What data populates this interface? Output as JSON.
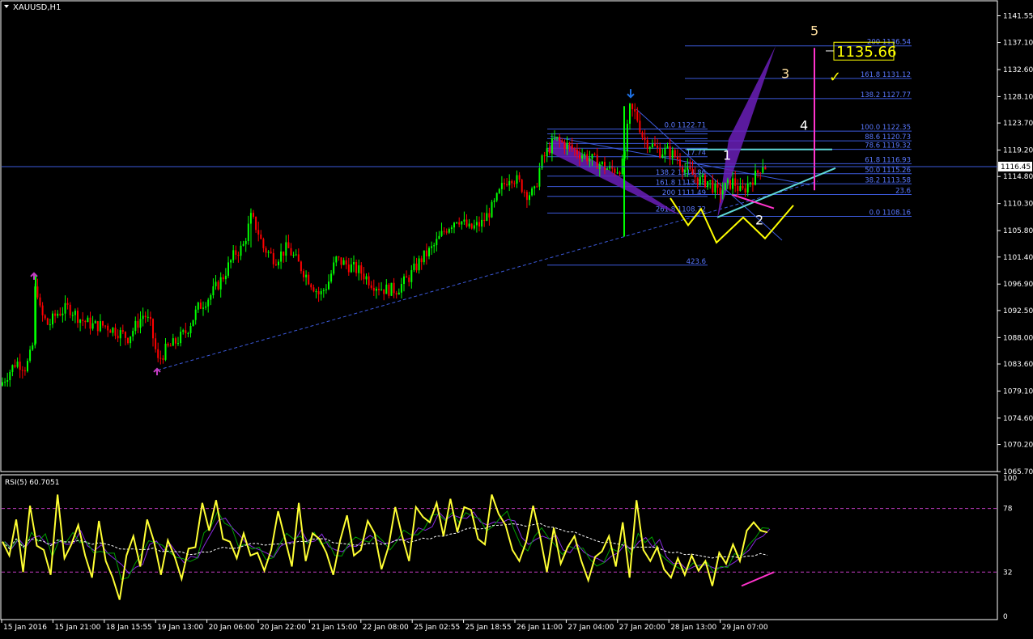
{
  "colors": {
    "background": "#000000",
    "frame": "#ffffff",
    "candle_up": "#00ff00",
    "candle_down": "#ff0000",
    "fib": "#3c5adc",
    "fib_text": "#5a78ff",
    "trend_dashed": "#3c5adc",
    "wave_yellow": "#ffff00",
    "teal": "#5fd7d7",
    "magenta": "#ff33cc",
    "purple_fill": "#6a1fb8",
    "rsi_line": "#ffff33",
    "rsi_signal": "#00a000",
    "rsi_signal2": "#8a2be2",
    "rsi_ma": "#ffffff",
    "rsi_level": "#c23cc2",
    "arrow_up": "#c23cc2",
    "arrow_down": "#1e6fe0",
    "price_label_bg": "#ffffff"
  },
  "header": {
    "symbol_label": "XAUUSD,H1",
    "menu_icon": "triangle-down-icon"
  },
  "chart_data": [
    {
      "type": "candlestick",
      "title": "XAUUSD,H1",
      "ylim": [
        1065.7,
        1143.5
      ],
      "y_ticks": [
        "1141.55",
        "1137.10",
        "1132.60",
        "1128.10",
        "1123.70",
        "1119.20",
        "1114.80",
        "1110.30",
        "1105.80",
        "1101.40",
        "1096.90",
        "1092.50",
        "1088.00",
        "1083.60",
        "1079.10",
        "1074.60",
        "1070.20",
        "1065.70"
      ],
      "current_price": "1116.45",
      "x_ticks": [
        "15 Jan 2016",
        "15 Jan 21:00",
        "18 Jan 15:55",
        "19 Jan 13:00",
        "20 Jan 06:00",
        "20 Jan 22:00",
        "21 Jan 15:00",
        "22 Jan 08:00",
        "25 Jan 02:55",
        "25 Jan 18:55",
        "26 Jan 11:00",
        "27 Jan 04:00",
        "27 Jan 20:00",
        "28 Jan 13:00",
        "29 Jan 07:00"
      ],
      "price_path": [
        [
          0,
          1080
        ],
        [
          10,
          1082
        ],
        [
          20,
          1084
        ],
        [
          32,
          1083
        ],
        [
          40,
          1086
        ],
        [
          44,
          1098
        ],
        [
          50,
          1092
        ],
        [
          60,
          1090
        ],
        [
          70,
          1092
        ],
        [
          85,
          1093
        ],
        [
          100,
          1091
        ],
        [
          115,
          1090
        ],
        [
          130,
          1090
        ],
        [
          145,
          1089
        ],
        [
          158,
          1088
        ],
        [
          168,
          1090
        ],
        [
          178,
          1092
        ],
        [
          186,
          1090
        ],
        [
          195,
          1084
        ],
        [
          205,
          1086
        ],
        [
          215,
          1087
        ],
        [
          230,
          1089
        ],
        [
          245,
          1093
        ],
        [
          260,
          1095
        ],
        [
          275,
          1098
        ],
        [
          290,
          1102
        ],
        [
          300,
          1103
        ],
        [
          310,
          1108
        ],
        [
          318,
          1106
        ],
        [
          325,
          1103
        ],
        [
          340,
          1101
        ],
        [
          355,
          1103
        ],
        [
          365,
          1101
        ],
        [
          380,
          1098
        ],
        [
          395,
          1095
        ],
        [
          405,
          1097
        ],
        [
          415,
          1101
        ],
        [
          430,
          1100
        ],
        [
          445,
          1099
        ],
        [
          460,
          1097
        ],
        [
          475,
          1096
        ],
        [
          490,
          1096
        ],
        [
          505,
          1098
        ],
        [
          520,
          1101
        ],
        [
          535,
          1103
        ],
        [
          550,
          1106
        ],
        [
          565,
          1108
        ],
        [
          580,
          1106
        ],
        [
          595,
          1107
        ],
        [
          610,
          1110
        ],
        [
          620,
          1113
        ],
        [
          630,
          1115
        ],
        [
          640,
          1114
        ],
        [
          650,
          1112
        ],
        [
          660,
          1112
        ],
        [
          668,
          1117
        ],
        [
          676,
          1119
        ],
        [
          686,
          1121
        ],
        [
          700,
          1120
        ],
        [
          712,
          1119
        ],
        [
          726,
          1118
        ],
        [
          740,
          1117
        ],
        [
          752,
          1116
        ],
        [
          764,
          1116
        ],
        [
          770,
          1117
        ],
        [
          778,
          1126
        ],
        [
          786,
          1125
        ],
        [
          795,
          1121
        ],
        [
          805,
          1120
        ],
        [
          815,
          1119
        ],
        [
          825,
          1119
        ],
        [
          836,
          1118
        ],
        [
          846,
          1116
        ],
        [
          856,
          1115
        ],
        [
          866,
          1114
        ],
        [
          876,
          1114
        ],
        [
          886,
          1112
        ],
        [
          896,
          1113
        ],
        [
          906,
          1114
        ],
        [
          916,
          1112
        ],
        [
          926,
          1114
        ],
        [
          934,
          1115
        ],
        [
          942,
          1117
        ],
        [
          948,
          1116
        ]
      ],
      "annotations": {
        "wave_labels": [
          "1",
          "2",
          "3",
          "4",
          "5"
        ],
        "big_price": "1135.66",
        "checkmark": "✓",
        "fib_left_labels": [
          "0.0 1122.71",
          "23.6",
          "38.2",
          "50.0",
          "61.8",
          "17.74",
          "138.2 1114.86",
          "161.8 1113.13",
          "200 1111.49",
          "261.8 1108.72",
          "423.6"
        ],
        "fib_right_labels": [
          "200 1136.54",
          "161.8 1131.12",
          "138.2 1127.77",
          "100.0 1122.35",
          "88.6 1120.73",
          "78.6 1119.32",
          "61.8 1116.93",
          "50.0 1115.26",
          "38.2 1113.58",
          "23.6",
          "0.0 1108.16"
        ]
      }
    },
    {
      "type": "line",
      "title": "RSI(5) 60.7051",
      "ylim": [
        0,
        100
      ],
      "y_ticks": [
        "100",
        "78",
        "32",
        "0"
      ],
      "levels": [
        78,
        32
      ],
      "series": [
        {
          "name": "RSI(5)",
          "values": [
            54,
            44,
            70,
            32,
            80,
            51,
            48,
            30,
            88,
            42,
            52,
            66,
            44,
            28,
            69,
            40,
            28,
            12,
            44,
            58,
            36,
            70,
            54,
            30,
            55,
            43,
            27,
            49,
            50,
            82,
            62,
            84,
            56,
            54,
            42,
            60,
            44,
            46,
            33,
            48,
            76,
            56,
            36,
            82,
            40,
            60,
            56,
            46,
            30,
            55,
            73,
            44,
            48,
            69,
            60,
            34,
            50,
            79,
            58,
            40,
            79,
            72,
            68,
            82,
            58,
            85,
            61,
            79,
            77,
            56,
            52,
            88,
            74,
            66,
            48,
            40,
            54,
            80,
            58,
            32,
            64,
            38,
            50,
            58,
            40,
            26,
            43,
            47,
            58,
            36,
            68,
            28,
            84,
            48,
            40,
            50,
            34,
            28,
            42,
            30,
            44,
            33,
            40,
            22,
            46,
            38,
            52,
            40,
            62,
            68,
            62,
            60.7
          ]
        }
      ]
    }
  ]
}
